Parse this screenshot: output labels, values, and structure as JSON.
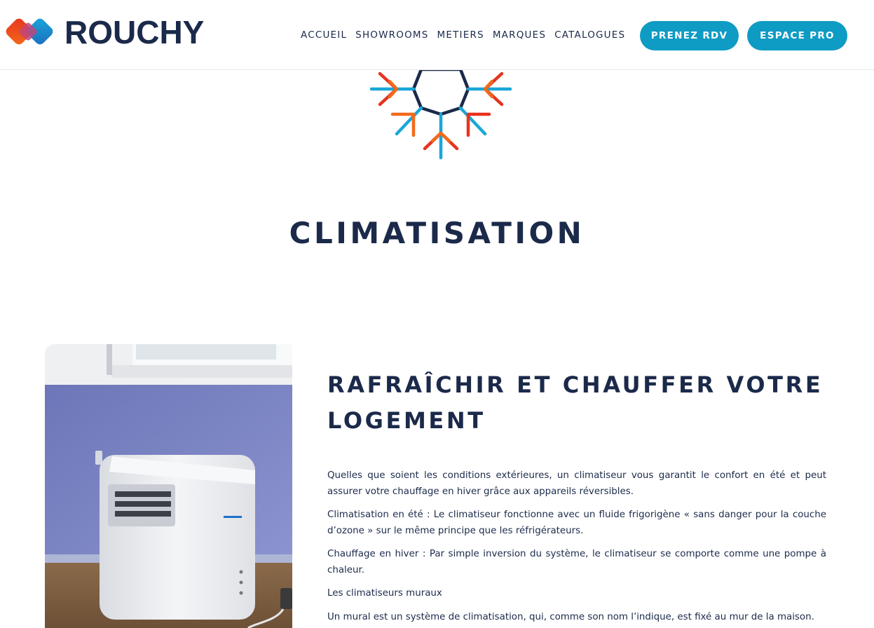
{
  "header": {
    "logo_text": "ROUCHY",
    "nav": [
      "ACCUEIL",
      "SHOWROOMS",
      "METIERS",
      "MARQUES",
      "CATALOGUES"
    ],
    "cta_rdv": "PRENEZ RDV",
    "cta_pro": "ESPACE PRO"
  },
  "page": {
    "title": "CLIMATISATION"
  },
  "section": {
    "heading": "RAFRAÎCHIR ET CHAUFFER VOTRE LOGEMENT",
    "paragraphs": [
      "Quelles que soient les conditions extérieures, un climatiseur vous garantit le confort en été et peut assurer votre chauffage en hiver grâce aux appareils réversibles.",
      "Climatisation en été : Le climatiseur fonctionne avec un fluide frigorigène « sans danger pour la couche d’ozone » sur le même principe que les réfrigérateurs.",
      "Chauffage en hiver : Par simple inversion du système, le climatiseur se comporte comme une pompe à chaleur."
    ],
    "subheading": "Les climatiseurs muraux",
    "last_paragraph": "Un mural est un système de climatisation, qui, comme son nom l’indique, est fixé au mur de la maison."
  },
  "colors": {
    "navy": "#1b2a4a",
    "accent": "#0e9bc4",
    "red": "#e8321e",
    "orange": "#f26a1b",
    "cyan": "#1aa6d8"
  },
  "icons": [
    "logo-mark-icon",
    "snowflake-icon"
  ]
}
